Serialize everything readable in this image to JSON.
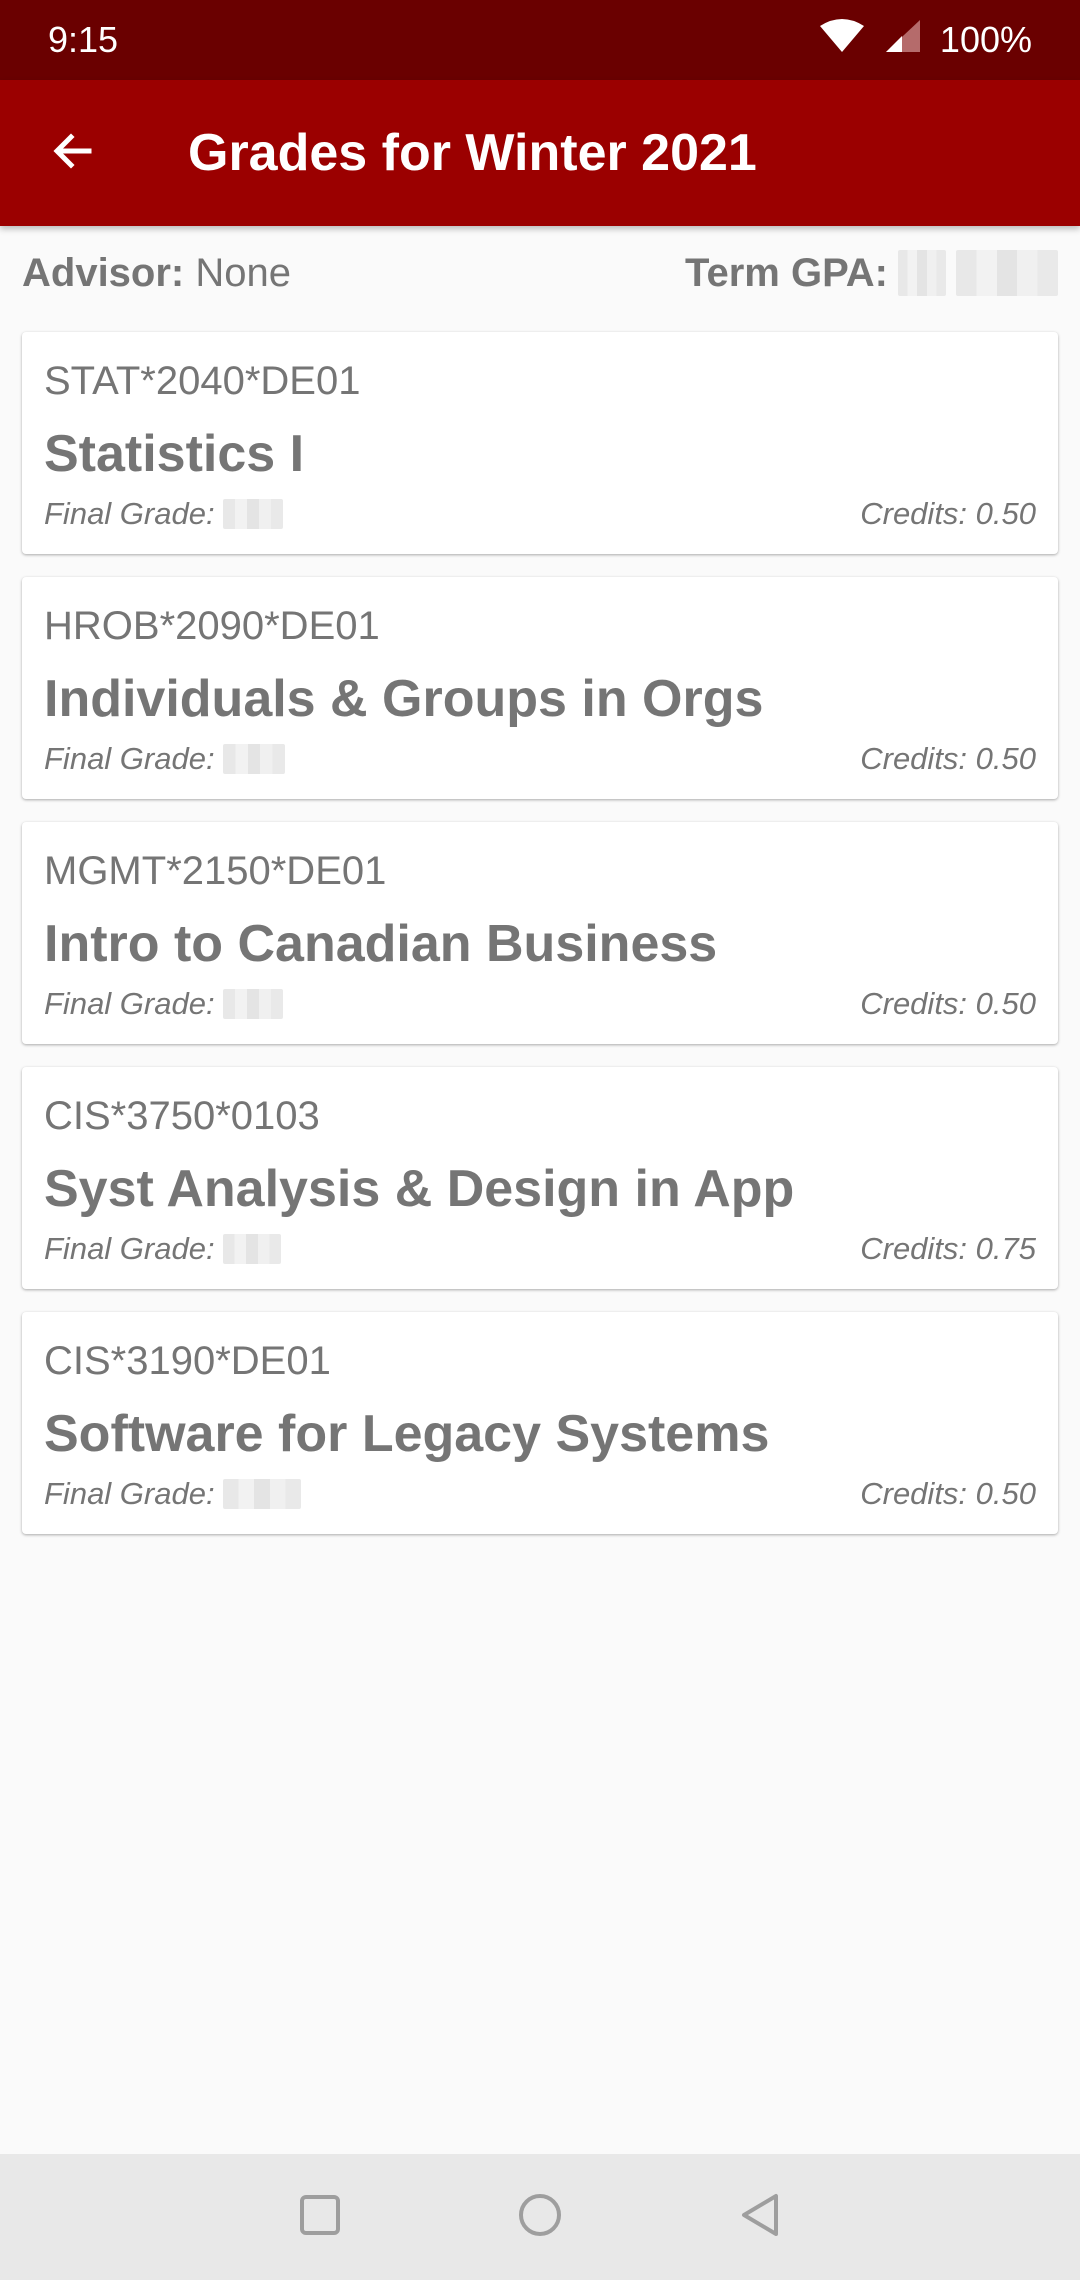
{
  "status_bar": {
    "time": "9:15",
    "battery": "100%",
    "icons": [
      "wifi-icon",
      "signal-icon"
    ]
  },
  "app_bar": {
    "title": "Grades for Winter 2021",
    "back_icon": "arrow-left-icon"
  },
  "summary": {
    "advisor_label": "Advisor:",
    "advisor_value": "None",
    "gpa_label": "Term GPA:"
  },
  "courses": [
    {
      "code": "STAT*2040*DE01",
      "title": "Statistics I",
      "grade_label": "Final Grade:",
      "credits": "Credits: 0.50"
    },
    {
      "code": "HROB*2090*DE01",
      "title": "Individuals & Groups in Orgs",
      "grade_label": "Final Grade:",
      "credits": "Credits: 0.50"
    },
    {
      "code": "MGMT*2150*DE01",
      "title": "Intro to Canadian Business",
      "grade_label": "Final Grade:",
      "credits": "Credits: 0.50"
    },
    {
      "code": "CIS*3750*0103",
      "title": "Syst Analysis & Design in App",
      "grade_label": "Final Grade:",
      "credits": "Credits: 0.75"
    },
    {
      "code": "CIS*3190*DE01",
      "title": "Software for Legacy Systems",
      "grade_label": "Final Grade:",
      "credits": "Credits: 0.50"
    }
  ],
  "nav_bar": {
    "icons": [
      "recent-apps-icon",
      "home-icon",
      "back-icon"
    ]
  },
  "colors": {
    "status_bar": "#6a0000",
    "app_bar": "#9b0000",
    "text_secondary": "#757575",
    "background": "#fafafa"
  }
}
